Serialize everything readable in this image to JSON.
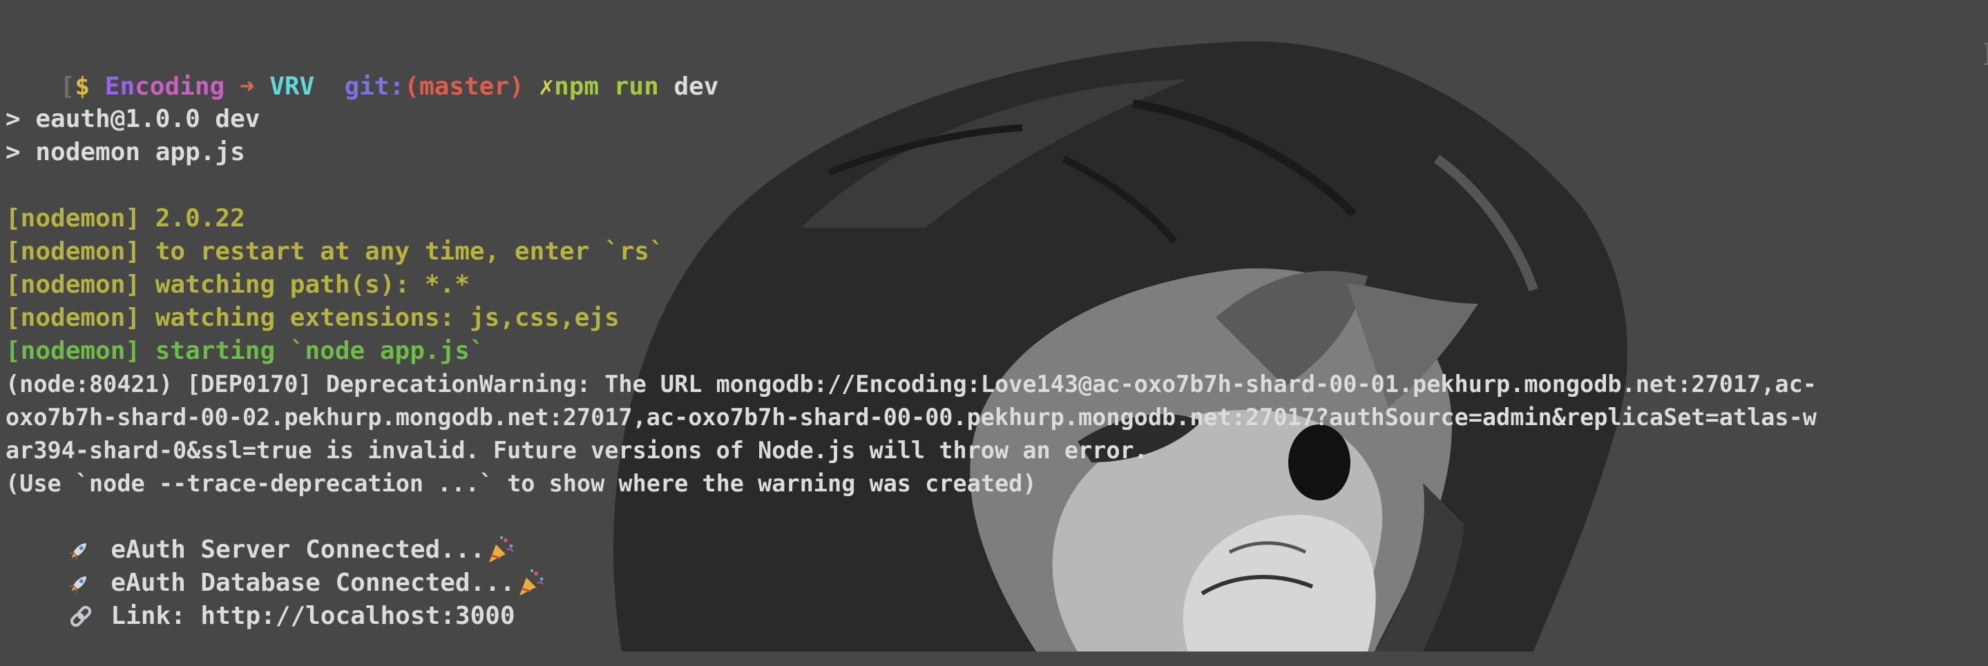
{
  "prompt": {
    "open_bracket": "[",
    "dollar": "$",
    "cwd_a": "En",
    "cwd_b": "coding",
    "arrow": " ➜ ",
    "dir": "VRV",
    "git_label": "  git:",
    "branch_open": "(",
    "branch": "master",
    "branch_close": ")",
    "dirty": " ✗",
    "command": "npm run",
    "command_arg": " dev",
    "close_bracket": "]"
  },
  "output": {
    "lines": [
      {
        "id": "npm-header-1",
        "text": "> eauth@1.0.0 dev"
      },
      {
        "id": "npm-header-2",
        "text": "> nodemon app.js"
      },
      {
        "id": "nodemon-version",
        "text": "[nodemon] 2.0.22"
      },
      {
        "id": "nodemon-restart",
        "text": "[nodemon] to restart at any time, enter `rs`"
      },
      {
        "id": "nodemon-watch-path",
        "text": "[nodemon] watching path(s): *.*"
      },
      {
        "id": "nodemon-watch-ext",
        "text": "[nodemon] watching extensions: js,css,ejs"
      },
      {
        "id": "nodemon-starting",
        "text": "[nodemon] starting `node app.js`"
      },
      {
        "id": "deprecation-1",
        "text": "(node:80421) [DEP0170] DeprecationWarning: The URL mongodb://Encoding:Love143@ac-oxo7b7h-shard-00-01.pekhurp.mongodb.net:27017,ac-"
      },
      {
        "id": "deprecation-2",
        "text": "oxo7b7h-shard-00-02.pekhurp.mongodb.net:27017,ac-oxo7b7h-shard-00-00.pekhurp.mongodb.net:27017?authSource=admin&replicaSet=atlas-w"
      },
      {
        "id": "deprecation-3",
        "text": "ar394-shard-0&ssl=true is invalid. Future versions of Node.js will throw an error."
      },
      {
        "id": "deprecation-4",
        "text": "(Use `node --trace-deprecation ...` to show where the warning was created)"
      }
    ],
    "server_connected": " eAuth Server Connected...",
    "database_connected": " eAuth Database Connected...",
    "link": " Link: http://localhost:3000"
  },
  "icons": {
    "rocket": "rocket-icon",
    "party": "party-popper-icon",
    "link": "link-icon"
  },
  "colors": {
    "background": "#474747",
    "text": "#dcdcdc",
    "nodemon_yellow": "#b6b43e",
    "nodemon_green": "#6fbb48"
  }
}
